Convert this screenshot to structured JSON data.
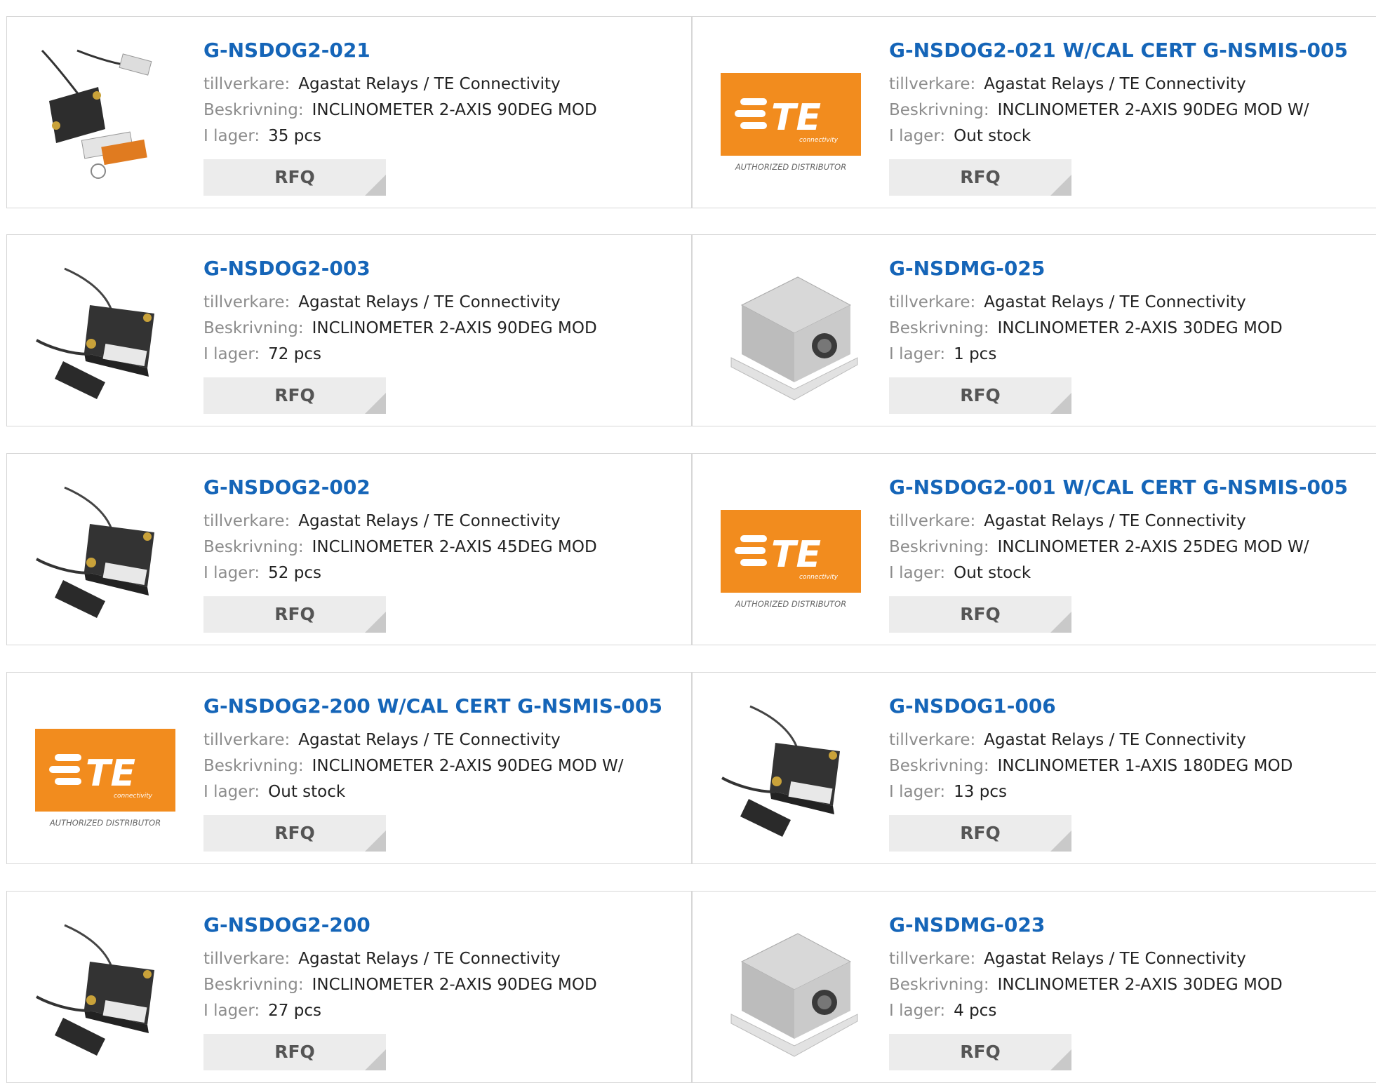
{
  "labels": {
    "manufacturer": "tillverkare:",
    "description": "Beskrivning:",
    "stock": "I lager:",
    "rfq": "RFQ"
  },
  "te_logo": {
    "brand": "TE",
    "sub": "connectivity",
    "caption": "AUTHORIZED DISTRIBUTOR",
    "color": "#f28c1e"
  },
  "products": [
    {
      "part": "G-NSDOG2-021",
      "manufacturer": "Agastat Relays / TE Connectivity",
      "description": "INCLINOMETER 2-AXIS 90DEG MOD",
      "stock": "35 pcs",
      "image": "usb-inclinometer-icon"
    },
    {
      "part": "G-NSDOG2-021 W/CAL CERT G-NSMIS-005",
      "manufacturer": "Agastat Relays / TE Connectivity",
      "description": "INCLINOMETER 2-AXIS 90DEG MOD W/",
      "stock": "Out stock",
      "image": "te-logo"
    },
    {
      "part": "G-NSDOG2-003",
      "manufacturer": "Agastat Relays / TE Connectivity",
      "description": "INCLINOMETER 2-AXIS 90DEG MOD",
      "stock": "72 pcs",
      "image": "cable-inclinometer-icon"
    },
    {
      "part": "G-NSDMG-025",
      "manufacturer": "Agastat Relays / TE Connectivity",
      "description": "INCLINOMETER 2-AXIS 30DEG MOD",
      "stock": "1 pcs",
      "image": "metal-inclinometer-icon"
    },
    {
      "part": "G-NSDOG2-002",
      "manufacturer": "Agastat Relays / TE Connectivity",
      "description": "INCLINOMETER 2-AXIS 45DEG MOD",
      "stock": "52 pcs",
      "image": "cable-inclinometer-icon"
    },
    {
      "part": "G-NSDOG2-001 W/CAL CERT G-NSMIS-005",
      "manufacturer": "Agastat Relays / TE Connectivity",
      "description": "INCLINOMETER 2-AXIS 25DEG MOD W/",
      "stock": "Out stock",
      "image": "te-logo"
    },
    {
      "part": "G-NSDOG2-200 W/CAL CERT G-NSMIS-005",
      "manufacturer": "Agastat Relays / TE Connectivity",
      "description": "INCLINOMETER 2-AXIS 90DEG MOD W/",
      "stock": "Out stock",
      "image": "te-logo"
    },
    {
      "part": "G-NSDOG1-006",
      "manufacturer": "Agastat Relays / TE Connectivity",
      "description": "INCLINOMETER 1-AXIS 180DEG MOD",
      "stock": "13 pcs",
      "image": "cable-inclinometer-icon"
    },
    {
      "part": "G-NSDOG2-200",
      "manufacturer": "Agastat Relays / TE Connectivity",
      "description": "INCLINOMETER 2-AXIS 90DEG MOD",
      "stock": "27 pcs",
      "image": "cable-inclinometer-icon"
    },
    {
      "part": "G-NSDMG-023",
      "manufacturer": "Agastat Relays / TE Connectivity",
      "description": "INCLINOMETER 2-AXIS 30DEG MOD",
      "stock": "4 pcs",
      "image": "metal-inclinometer-icon"
    }
  ]
}
